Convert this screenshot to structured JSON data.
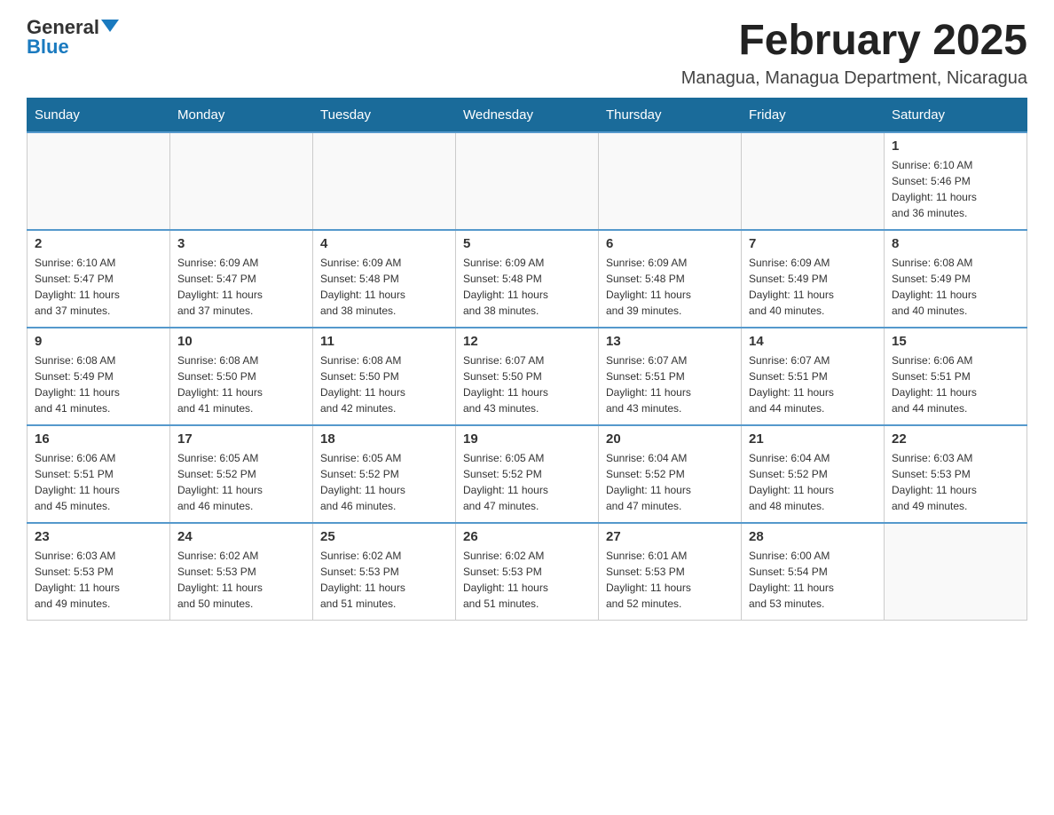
{
  "header": {
    "logo_general": "General",
    "logo_blue": "Blue",
    "month_title": "February 2025",
    "location": "Managua, Managua Department, Nicaragua"
  },
  "weekdays": [
    "Sunday",
    "Monday",
    "Tuesday",
    "Wednesday",
    "Thursday",
    "Friday",
    "Saturday"
  ],
  "weeks": [
    [
      {
        "day": "",
        "info": ""
      },
      {
        "day": "",
        "info": ""
      },
      {
        "day": "",
        "info": ""
      },
      {
        "day": "",
        "info": ""
      },
      {
        "day": "",
        "info": ""
      },
      {
        "day": "",
        "info": ""
      },
      {
        "day": "1",
        "info": "Sunrise: 6:10 AM\nSunset: 5:46 PM\nDaylight: 11 hours\nand 36 minutes."
      }
    ],
    [
      {
        "day": "2",
        "info": "Sunrise: 6:10 AM\nSunset: 5:47 PM\nDaylight: 11 hours\nand 37 minutes."
      },
      {
        "day": "3",
        "info": "Sunrise: 6:09 AM\nSunset: 5:47 PM\nDaylight: 11 hours\nand 37 minutes."
      },
      {
        "day": "4",
        "info": "Sunrise: 6:09 AM\nSunset: 5:48 PM\nDaylight: 11 hours\nand 38 minutes."
      },
      {
        "day": "5",
        "info": "Sunrise: 6:09 AM\nSunset: 5:48 PM\nDaylight: 11 hours\nand 38 minutes."
      },
      {
        "day": "6",
        "info": "Sunrise: 6:09 AM\nSunset: 5:48 PM\nDaylight: 11 hours\nand 39 minutes."
      },
      {
        "day": "7",
        "info": "Sunrise: 6:09 AM\nSunset: 5:49 PM\nDaylight: 11 hours\nand 40 minutes."
      },
      {
        "day": "8",
        "info": "Sunrise: 6:08 AM\nSunset: 5:49 PM\nDaylight: 11 hours\nand 40 minutes."
      }
    ],
    [
      {
        "day": "9",
        "info": "Sunrise: 6:08 AM\nSunset: 5:49 PM\nDaylight: 11 hours\nand 41 minutes."
      },
      {
        "day": "10",
        "info": "Sunrise: 6:08 AM\nSunset: 5:50 PM\nDaylight: 11 hours\nand 41 minutes."
      },
      {
        "day": "11",
        "info": "Sunrise: 6:08 AM\nSunset: 5:50 PM\nDaylight: 11 hours\nand 42 minutes."
      },
      {
        "day": "12",
        "info": "Sunrise: 6:07 AM\nSunset: 5:50 PM\nDaylight: 11 hours\nand 43 minutes."
      },
      {
        "day": "13",
        "info": "Sunrise: 6:07 AM\nSunset: 5:51 PM\nDaylight: 11 hours\nand 43 minutes."
      },
      {
        "day": "14",
        "info": "Sunrise: 6:07 AM\nSunset: 5:51 PM\nDaylight: 11 hours\nand 44 minutes."
      },
      {
        "day": "15",
        "info": "Sunrise: 6:06 AM\nSunset: 5:51 PM\nDaylight: 11 hours\nand 44 minutes."
      }
    ],
    [
      {
        "day": "16",
        "info": "Sunrise: 6:06 AM\nSunset: 5:51 PM\nDaylight: 11 hours\nand 45 minutes."
      },
      {
        "day": "17",
        "info": "Sunrise: 6:05 AM\nSunset: 5:52 PM\nDaylight: 11 hours\nand 46 minutes."
      },
      {
        "day": "18",
        "info": "Sunrise: 6:05 AM\nSunset: 5:52 PM\nDaylight: 11 hours\nand 46 minutes."
      },
      {
        "day": "19",
        "info": "Sunrise: 6:05 AM\nSunset: 5:52 PM\nDaylight: 11 hours\nand 47 minutes."
      },
      {
        "day": "20",
        "info": "Sunrise: 6:04 AM\nSunset: 5:52 PM\nDaylight: 11 hours\nand 47 minutes."
      },
      {
        "day": "21",
        "info": "Sunrise: 6:04 AM\nSunset: 5:52 PM\nDaylight: 11 hours\nand 48 minutes."
      },
      {
        "day": "22",
        "info": "Sunrise: 6:03 AM\nSunset: 5:53 PM\nDaylight: 11 hours\nand 49 minutes."
      }
    ],
    [
      {
        "day": "23",
        "info": "Sunrise: 6:03 AM\nSunset: 5:53 PM\nDaylight: 11 hours\nand 49 minutes."
      },
      {
        "day": "24",
        "info": "Sunrise: 6:02 AM\nSunset: 5:53 PM\nDaylight: 11 hours\nand 50 minutes."
      },
      {
        "day": "25",
        "info": "Sunrise: 6:02 AM\nSunset: 5:53 PM\nDaylight: 11 hours\nand 51 minutes."
      },
      {
        "day": "26",
        "info": "Sunrise: 6:02 AM\nSunset: 5:53 PM\nDaylight: 11 hours\nand 51 minutes."
      },
      {
        "day": "27",
        "info": "Sunrise: 6:01 AM\nSunset: 5:53 PM\nDaylight: 11 hours\nand 52 minutes."
      },
      {
        "day": "28",
        "info": "Sunrise: 6:00 AM\nSunset: 5:54 PM\nDaylight: 11 hours\nand 53 minutes."
      },
      {
        "day": "",
        "info": ""
      }
    ]
  ]
}
